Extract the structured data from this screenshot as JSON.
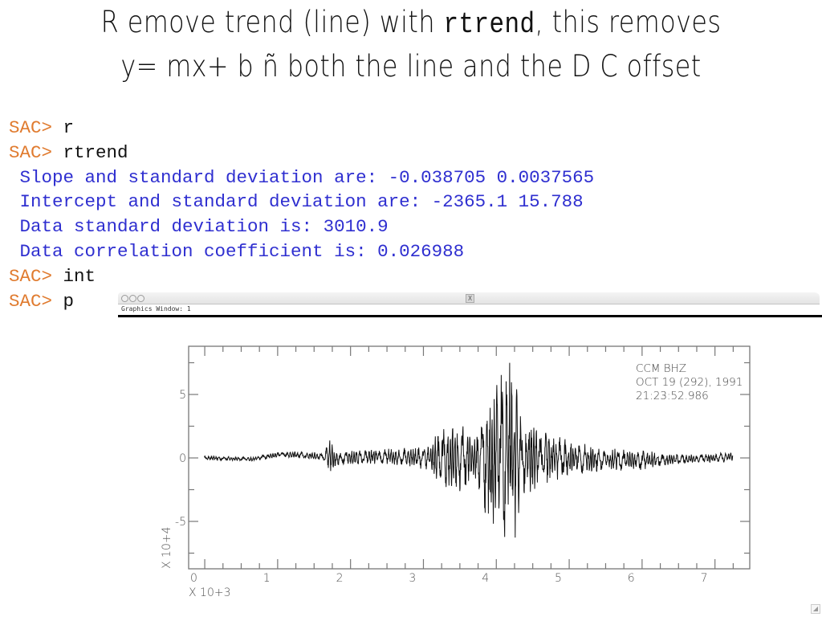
{
  "slide": {
    "title_line1_pre": "R emove trend (line) with ",
    "title_line1_cmd": "rtrend",
    "title_line1_post": ", this removes",
    "title_line2": "y= mx+ b ñ both the line and the D C  offset"
  },
  "terminal": {
    "prompt": "SAC> ",
    "lines": [
      {
        "type": "cmd",
        "text": "r"
      },
      {
        "type": "cmd",
        "text": "rtrend"
      },
      {
        "type": "out",
        "text": " Slope and standard deviation are: -0.038705 0.0037565"
      },
      {
        "type": "out",
        "text": " Intercept and standard deviation are: -2365.1 15.788"
      },
      {
        "type": "out",
        "text": " Data standard deviation is: 3010.9"
      },
      {
        "type": "out",
        "text": " Data correlation coefficient is: 0.026988"
      },
      {
        "type": "cmd",
        "text": "int"
      },
      {
        "type": "cmd",
        "text": "p"
      }
    ],
    "colors": {
      "prompt": "#e07b2f",
      "command": "#111111",
      "output": "#2f2fd0"
    }
  },
  "graphics_window": {
    "title": "Graphics Window:  1",
    "x11_icon": "X"
  },
  "chart_data": {
    "type": "line",
    "title": "",
    "header": [
      "CCM   BHZ",
      "OCT 19 (292), 1991",
      "21:23:52.986"
    ],
    "xlabel": "",
    "x_multiplier_label": "X  10+3",
    "y_multiplier_label": "X  10+4",
    "xlim": [
      0,
      7.65
    ],
    "ylim": [
      -8.7,
      8.8
    ],
    "x_ticks": [
      "0",
      "1",
      "2",
      "3",
      "4",
      "5",
      "6",
      "7"
    ],
    "y_ticks": [
      "5",
      "0",
      "-5"
    ],
    "series": [
      {
        "name": "CCM BHZ seismogram (detrended)",
        "description": "Seismic trace: quiet pre-event noise ~0, small P arrival near x=1.85, growing oscillation from ~3.3, peak amplitude ~+8.5 / -8.2 (x10^4) near x=4.35, decaying coda to x=7.4",
        "envelope": [
          {
            "x": 0.15,
            "amp": 0.15,
            "offset": 0.0
          },
          {
            "x": 0.8,
            "amp": 0.15,
            "offset": -0.1
          },
          {
            "x": 1.2,
            "amp": 0.2,
            "offset": 0.3
          },
          {
            "x": 1.8,
            "amp": 0.3,
            "offset": 0.1
          },
          {
            "x": 1.85,
            "amp": 1.4,
            "offset": 0.0
          },
          {
            "x": 2.0,
            "amp": 0.5,
            "offset": 0.0
          },
          {
            "x": 2.8,
            "amp": 0.6,
            "offset": 0.1
          },
          {
            "x": 3.25,
            "amp": 0.9,
            "offset": 0.0
          },
          {
            "x": 3.35,
            "amp": 2.0,
            "offset": 0.0
          },
          {
            "x": 3.7,
            "amp": 2.7,
            "offset": 0.0
          },
          {
            "x": 3.85,
            "amp": 1.5,
            "offset": 0.0
          },
          {
            "x": 4.05,
            "amp": 5.0,
            "offset": 0.0
          },
          {
            "x": 4.25,
            "amp": 6.5,
            "offset": 0.0
          },
          {
            "x": 4.35,
            "amp": 8.4,
            "offset": 0.0
          },
          {
            "x": 4.5,
            "amp": 3.0,
            "offset": 0.0
          },
          {
            "x": 5.0,
            "amp": 1.6,
            "offset": 0.0
          },
          {
            "x": 5.5,
            "amp": 0.9,
            "offset": -0.1
          },
          {
            "x": 6.2,
            "amp": 0.7,
            "offset": -0.2
          },
          {
            "x": 6.7,
            "amp": 0.35,
            "offset": -0.1
          },
          {
            "x": 7.4,
            "amp": 0.35,
            "offset": 0.05
          }
        ]
      }
    ],
    "grid": false,
    "legend": "none"
  }
}
